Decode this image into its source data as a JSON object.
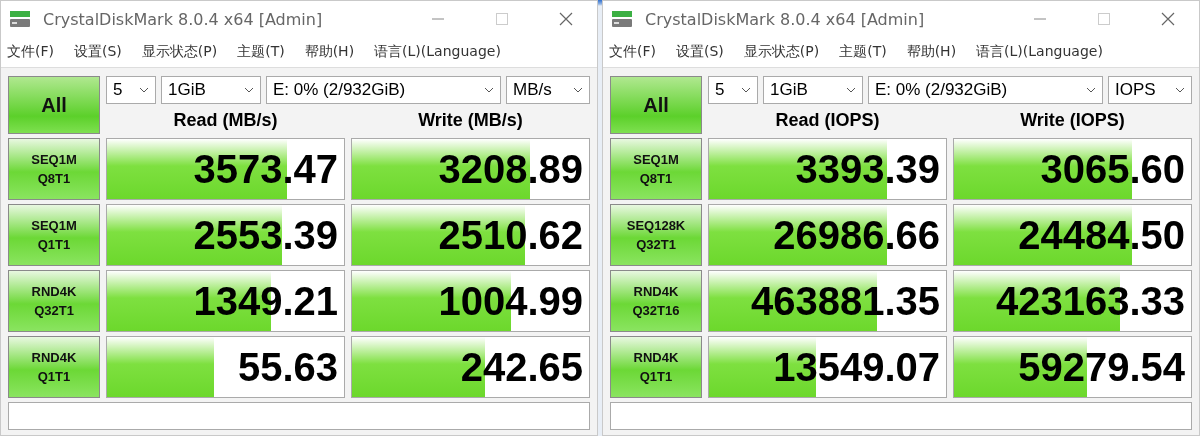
{
  "windows": [
    {
      "title": "CrystalDiskMark 8.0.4 x64 [Admin]",
      "menu": [
        "文件(F)",
        "设置(S)",
        "显示状态(P)",
        "主题(T)",
        "帮助(H)",
        "语言(L)(Language)"
      ],
      "all_button": "All",
      "count": "5",
      "size": "1GiB",
      "drive": "E: 0% (2/932GiB)",
      "unit": "MB/s",
      "read_header": "Read (MB/s)",
      "write_header": "Write (MB/s)",
      "tests": [
        {
          "line1": "SEQ1M",
          "line2": "Q8T1",
          "read": {
            "value": "3573.47",
            "level": 0.76
          },
          "write": {
            "value": "3208.89",
            "level": 0.75
          }
        },
        {
          "line1": "SEQ1M",
          "line2": "Q1T1",
          "read": {
            "value": "2553.39",
            "level": 0.74
          },
          "write": {
            "value": "2510.62",
            "level": 0.73
          }
        },
        {
          "line1": "RND4K",
          "line2": "Q32T1",
          "read": {
            "value": "1349.21",
            "level": 0.69
          },
          "write": {
            "value": "1004.99",
            "level": 0.67
          }
        },
        {
          "line1": "RND4K",
          "line2": "Q1T1",
          "read": {
            "value": "55.63",
            "level": 0.45
          },
          "write": {
            "value": "242.65",
            "level": 0.56
          }
        }
      ]
    },
    {
      "title": "CrystalDiskMark 8.0.4 x64 [Admin]",
      "menu": [
        "文件(F)",
        "设置(S)",
        "显示状态(P)",
        "主题(T)",
        "帮助(H)",
        "语言(L)(Language)"
      ],
      "all_button": "All",
      "count": "5",
      "size": "1GiB",
      "drive": "E: 0% (2/932GiB)",
      "unit": "IOPS",
      "read_header": "Read (IOPS)",
      "write_header": "Write (IOPS)",
      "tests": [
        {
          "line1": "SEQ1M",
          "line2": "Q8T1",
          "read": {
            "value": "3393.39",
            "level": 0.75
          },
          "write": {
            "value": "3065.60",
            "level": 0.75
          }
        },
        {
          "line1": "SEQ128K",
          "line2": "Q32T1",
          "read": {
            "value": "26986.66",
            "level": 0.75
          },
          "write": {
            "value": "24484.50",
            "level": 0.75
          }
        },
        {
          "line1": "RND4K",
          "line2": "Q32T16",
          "read": {
            "value": "463881.35",
            "level": 0.71
          },
          "write": {
            "value": "423163.33",
            "level": 0.7
          }
        },
        {
          "line1": "RND4K",
          "line2": "Q1T1",
          "read": {
            "value": "13549.07",
            "level": 0.45
          },
          "write": {
            "value": "59279.54",
            "level": 0.56
          }
        }
      ]
    }
  ]
}
